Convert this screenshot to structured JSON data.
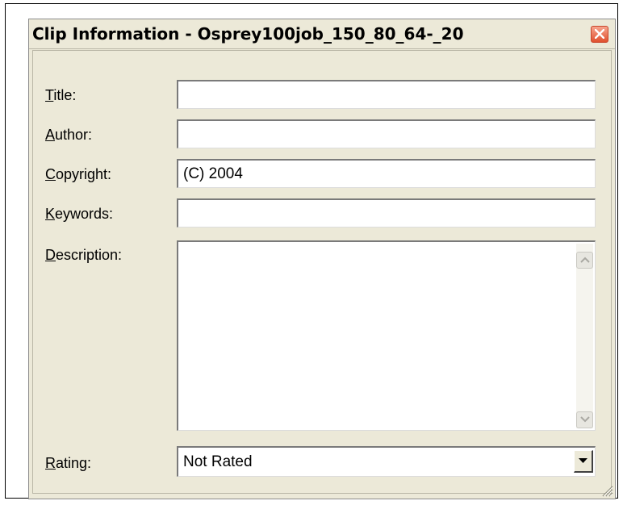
{
  "dialog": {
    "title": "Clip Information - Osprey100job_150_80_64-_20"
  },
  "fields": {
    "title": {
      "label_accel": "T",
      "label_rest": "itle:",
      "value": ""
    },
    "author": {
      "label_accel": "A",
      "label_rest": "uthor:",
      "value": ""
    },
    "copyright": {
      "label_accel": "C",
      "label_rest": "opyright:",
      "value": "(C) 2004"
    },
    "keywords": {
      "label_accel": "K",
      "label_rest": "eywords:",
      "value": ""
    },
    "description": {
      "label_accel": "D",
      "label_rest": "escription:",
      "value": ""
    },
    "rating": {
      "label_accel": "R",
      "label_rest": "ating:",
      "selected": "Not Rated"
    }
  },
  "icons": {
    "close": "close-icon",
    "scroll_up": "arrow-up-icon",
    "scroll_down": "arrow-down-icon",
    "dropdown": "chevron-down-icon",
    "resize": "resize-grip-icon"
  },
  "colors": {
    "dialog_bg": "#ece9d8",
    "close_button": "#e0512f"
  }
}
